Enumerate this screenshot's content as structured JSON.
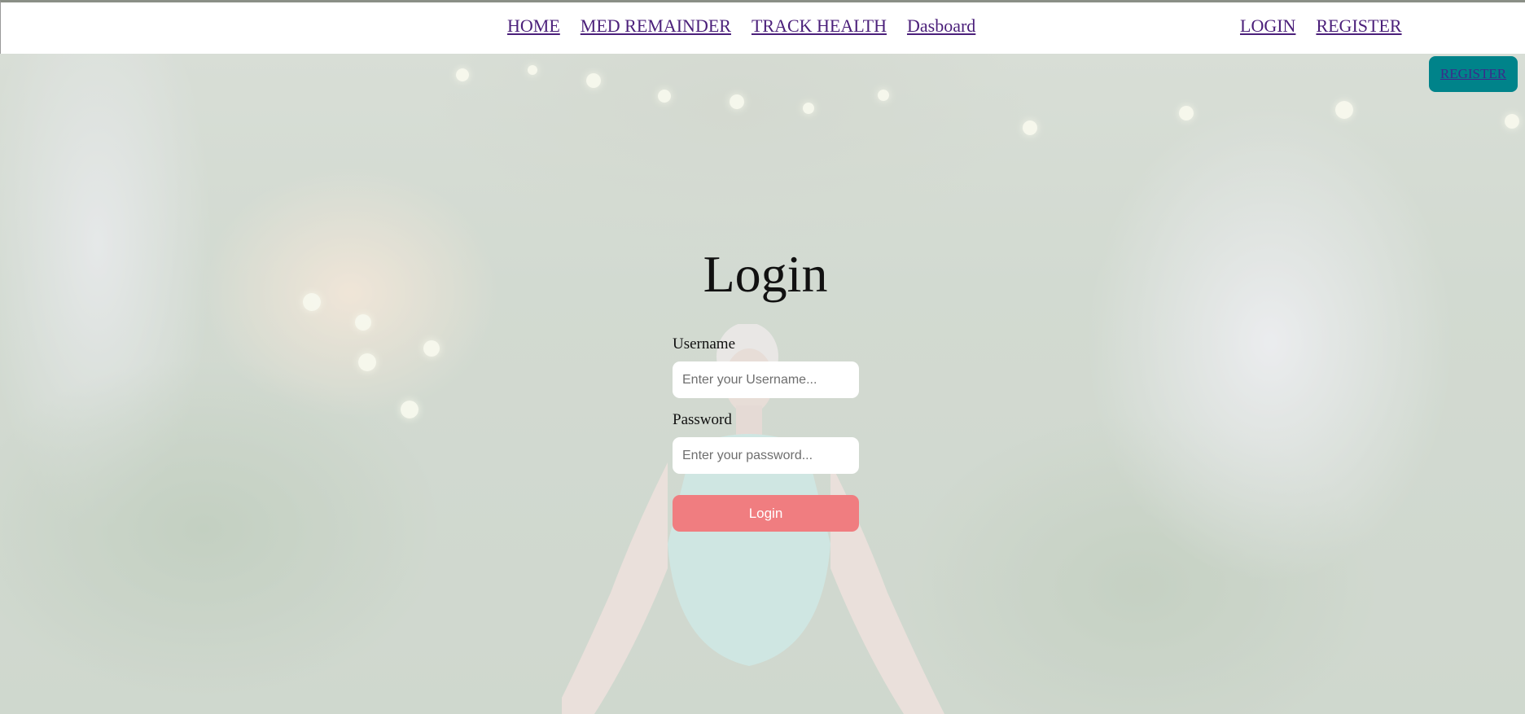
{
  "nav": {
    "center_links": [
      "HOME",
      "MED REMAINDER",
      "TRACK HEALTH",
      "Dasboard"
    ],
    "right_links": [
      "LOGIN",
      "REGISTER"
    ]
  },
  "floating_button": {
    "label": "REGISTER"
  },
  "login": {
    "title": "Login",
    "username_label": "Username",
    "username_placeholder": "Enter your Username...",
    "password_label": "Password",
    "password_placeholder": "Enter your password...",
    "submit_label": "Login"
  },
  "colors": {
    "nav_link": "#4b1f7a",
    "floating_button_bg": "#00838a",
    "login_button_bg": "#f07d80"
  }
}
